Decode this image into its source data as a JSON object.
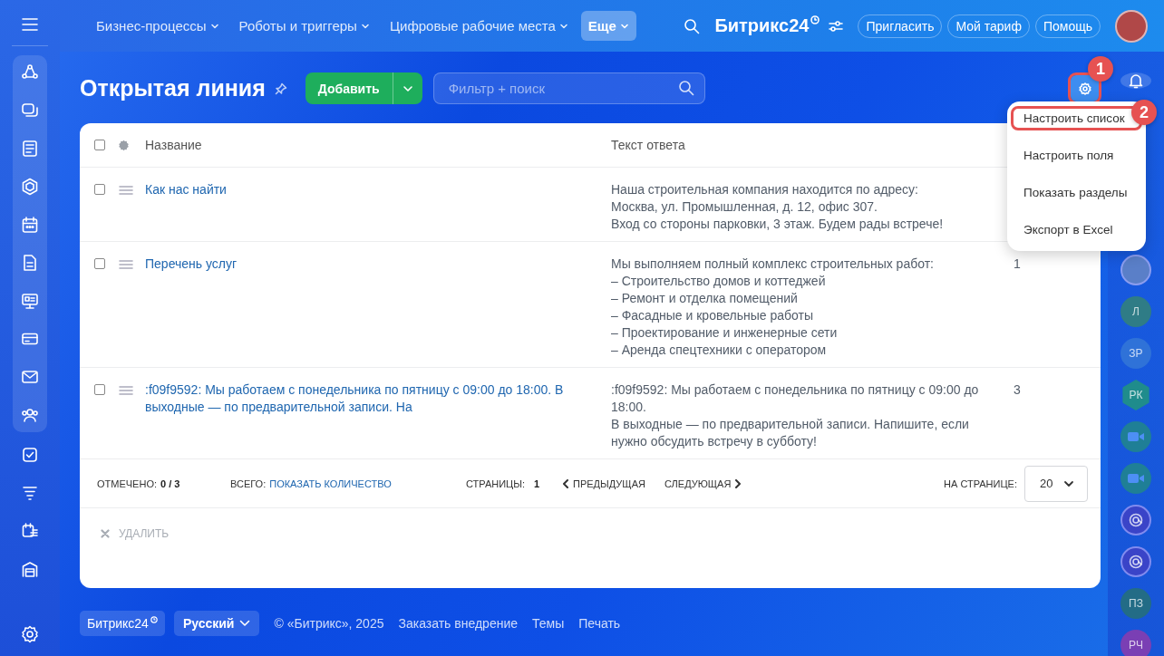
{
  "topnav": {
    "items": [
      {
        "label": "Бизнес-процессы",
        "selected": false
      },
      {
        "label": "Роботы и триггеры",
        "selected": false
      },
      {
        "label": "Цифровые рабочие места",
        "selected": false
      },
      {
        "label": "Еще",
        "selected": true
      }
    ],
    "logo": "Битрикс24",
    "buttons": [
      "Пригласить",
      "Мой тариф",
      "Помощь"
    ]
  },
  "page": {
    "title": "Открытая линия",
    "add_button": "Добавить",
    "search": {
      "placeholder": "Фильтр + поиск"
    }
  },
  "settings_menu": {
    "items": [
      {
        "label": "Настроить список",
        "highlighted": true
      },
      {
        "label": "Настроить поля",
        "highlighted": false
      },
      {
        "label": "Показать разделы",
        "highlighted": false
      },
      {
        "label": "Экспорт в Excel",
        "highlighted": false
      }
    ]
  },
  "callouts": [
    "1",
    "2"
  ],
  "table": {
    "select_all_checked": false,
    "columns": [
      "Название",
      "Текст ответа"
    ],
    "rows": [
      {
        "checked": false,
        "name": "Как нас найти",
        "text": [
          "Наша строительная компания находится по адресу:",
          "Москва, ул. Промышленная, д. 12, офис 307.",
          "Вход со стороны парковки, 3 этаж. Будем рады встрече!"
        ]
      },
      {
        "checked": false,
        "name": "Перечень услуг",
        "text": [
          "Мы выполняем полный комплекс строительных работ:",
          "– Строительство домов и коттеджей",
          "– Ремонт и отделка помещений",
          "– Фасадные и кровельные работы",
          "– Проектирование и инженерные сети",
          "– Аренда спецтехники с оператором"
        ],
        "column_3": "1"
      },
      {
        "checked": false,
        "name": ":f09f9592: Мы работаем с понедельника по пятницу с 09:00 до 18:00. В выходные — по предварительной записи. На",
        "text": [
          ":f09f9592: Мы работаем с понедельника по пятницу с 09:00 до 18:00.",
          "В выходные — по предварительной записи. Напишите, если нужно обсудить встречу в субботу!"
        ],
        "column_3": "3"
      }
    ]
  },
  "pager": {
    "selected_label": "ОТМЕЧЕНО:",
    "selected_value": "0 / 3",
    "total_label": "ВСЕГО:",
    "total_link": "ПОКАЗАТЬ КОЛИЧЕСТВО",
    "pages_label": "СТРАНИЦЫ:",
    "page": "1",
    "prev": "ПРЕДЫДУЩАЯ",
    "next": "СЛЕДУЮЩАЯ",
    "per_page_label": "НА СТРАНИЦЕ:",
    "per_page": "20"
  },
  "actions": [
    {
      "label": "УДАЛИТЬ",
      "disabled": true
    }
  ],
  "right_rail": {
    "items": [
      {
        "kind": "photo",
        "color": "#5a7fc8"
      },
      {
        "kind": "initials",
        "text": "Л",
        "color": "#2f7c86"
      },
      {
        "kind": "initials",
        "text": "ЗР",
        "color": "#2f72d8"
      },
      {
        "kind": "hex",
        "text": "РК",
        "color": "#1f8c8c"
      },
      {
        "kind": "video",
        "color": "#1f7f96"
      },
      {
        "kind": "video",
        "color": "#1f7f96"
      },
      {
        "kind": "chat",
        "color": "#3a44c8"
      },
      {
        "kind": "chat",
        "color": "#3a44c8"
      },
      {
        "kind": "initials",
        "text": "ПЗ",
        "color": "#236c86"
      },
      {
        "kind": "initials",
        "text": "РЧ",
        "color": "#7a3fb4"
      }
    ]
  },
  "footer": {
    "brand": "Битрикс24",
    "language": "Русский",
    "copyright": "© «Битрикс», 2025",
    "links": [
      "Заказать внедрение",
      "Темы",
      "Печать"
    ]
  }
}
